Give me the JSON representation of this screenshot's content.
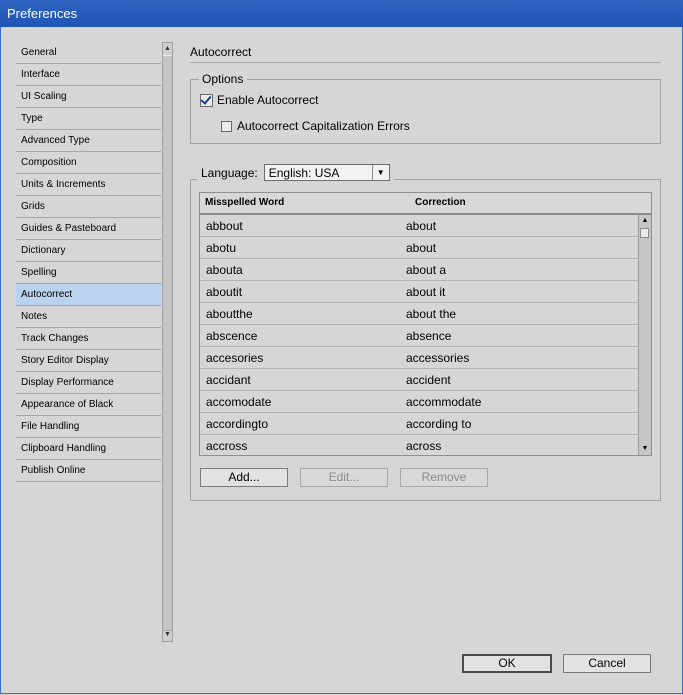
{
  "window": {
    "title": "Preferences"
  },
  "sidebar": {
    "items": [
      "General",
      "Interface",
      "UI Scaling",
      "Type",
      "Advanced Type",
      "Composition",
      "Units & Increments",
      "Grids",
      "Guides & Pasteboard",
      "Dictionary",
      "Spelling",
      "Autocorrect",
      "Notes",
      "Track Changes",
      "Story Editor Display",
      "Display Performance",
      "Appearance of Black",
      "File Handling",
      "Clipboard Handling",
      "Publish Online"
    ],
    "selected": "Autocorrect"
  },
  "main": {
    "title": "Autocorrect",
    "options": {
      "legend": "Options",
      "enable_label": "Enable Autocorrect",
      "enable_checked": true,
      "caps_label": "Autocorrect Capitalization Errors",
      "caps_checked": false
    },
    "language": {
      "label": "Language:",
      "value": "English: USA"
    },
    "table": {
      "headers": [
        "Misspelled Word",
        "Correction"
      ],
      "rows": [
        [
          "abbout",
          "about"
        ],
        [
          "abotu",
          "about"
        ],
        [
          "abouta",
          "about a"
        ],
        [
          "aboutit",
          "about it"
        ],
        [
          "aboutthe",
          "about the"
        ],
        [
          "abscence",
          "absence"
        ],
        [
          "accesories",
          "accessories"
        ],
        [
          "accidant",
          "accident"
        ],
        [
          "accomodate",
          "accommodate"
        ],
        [
          "accordingto",
          "according to"
        ],
        [
          "accross",
          "across"
        ]
      ]
    },
    "buttons": {
      "add": "Add...",
      "edit": "Edit...",
      "remove": "Remove"
    }
  },
  "footer": {
    "ok": "OK",
    "cancel": "Cancel"
  },
  "colors": {
    "titlebar": "#1f55b5",
    "selection": "#b9d2ee",
    "background": "#d6d6d6"
  }
}
